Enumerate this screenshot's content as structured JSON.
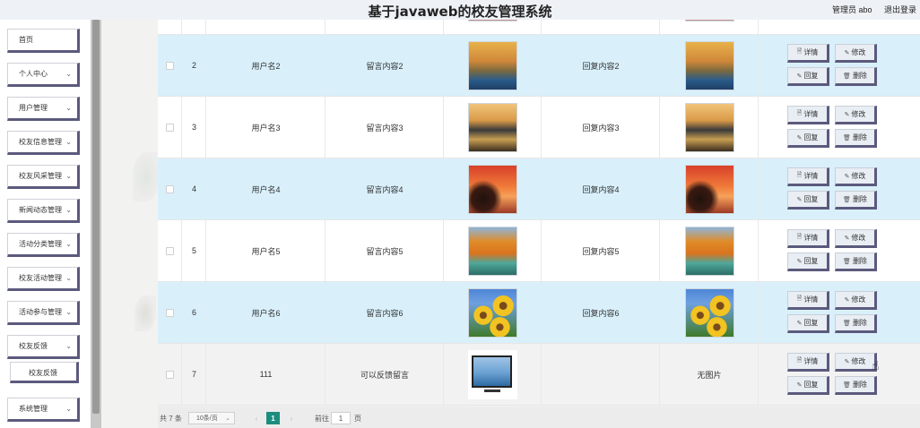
{
  "header": {
    "title": "基于javaweb的校友管理系统",
    "admin_label": "管理员 abo",
    "logout_label": "退出登录"
  },
  "sidebar": {
    "items": [
      {
        "label": "首页",
        "chevron": false
      },
      {
        "label": "个人中心",
        "chevron": true
      },
      {
        "label": "用户管理",
        "chevron": true
      },
      {
        "label": "校友信息管理",
        "chevron": true
      },
      {
        "label": "校友风采管理",
        "chevron": true
      },
      {
        "label": "新闻动态管理",
        "chevron": true
      },
      {
        "label": "活动分类管理",
        "chevron": true
      },
      {
        "label": "校友活动管理",
        "chevron": true
      },
      {
        "label": "活动参与管理",
        "chevron": true
      },
      {
        "label": "校友反馈",
        "chevron": true
      },
      {
        "label": "校友反馈",
        "chevron": false,
        "sub": true
      },
      {
        "label": "系统管理",
        "chevron": true
      }
    ]
  },
  "table": {
    "rows": [
      {
        "index": "2",
        "username": "用户名2",
        "message": "留言内容2",
        "reply": "回复内容2",
        "image": "road",
        "reply_image": "road"
      },
      {
        "index": "3",
        "username": "用户名3",
        "message": "留言内容3",
        "reply": "回复内容3",
        "image": "sunset",
        "reply_image": "sunset"
      },
      {
        "index": "4",
        "username": "用户名4",
        "message": "留言内容4",
        "reply": "回复内容4",
        "image": "tree",
        "reply_image": "tree"
      },
      {
        "index": "5",
        "username": "用户名5",
        "message": "留言内容5",
        "reply": "回复内容5",
        "image": "autumn",
        "reply_image": "autumn"
      },
      {
        "index": "6",
        "username": "用户名6",
        "message": "留言内容6",
        "reply": "回复内容6",
        "image": "sunflower",
        "reply_image": "sunflower"
      },
      {
        "index": "7",
        "username": "111",
        "message": "可以反馈留言",
        "reply": "",
        "image": "tv",
        "reply_image": "",
        "no_image_label": "无图片"
      }
    ],
    "actions": {
      "detail": "详情",
      "edit": "修改",
      "reply": "回复",
      "delete": "删除"
    }
  },
  "pagination": {
    "total_label": "共 7 条",
    "page_size_label": "10条/页",
    "current_page": "1",
    "goto_label": "前往",
    "goto_value": "1",
    "page_unit": "页"
  }
}
